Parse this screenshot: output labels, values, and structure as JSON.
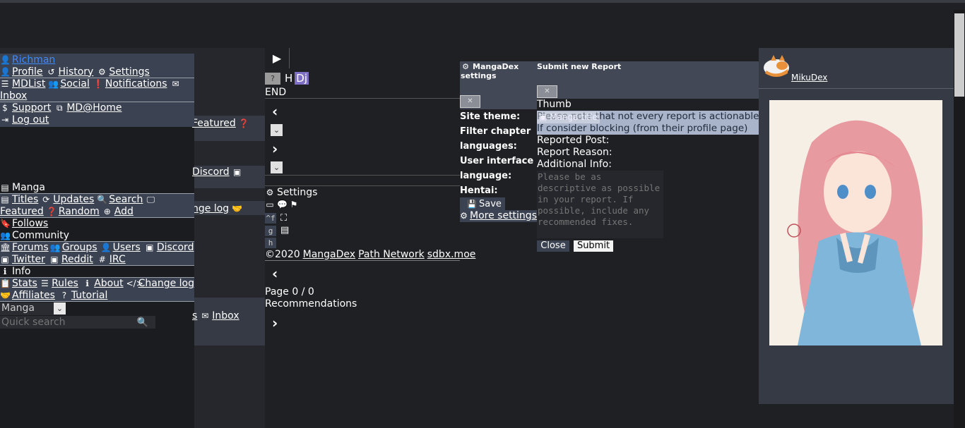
{
  "user_menu": {
    "username": "Richman",
    "profile": "Profile",
    "history": "History",
    "settings": "Settings",
    "mdlist": "MDList",
    "social": "Social",
    "notifications": "Notifications",
    "inbox": "Inbox",
    "support": "Support",
    "md_home": "MD@Home",
    "logout": "Log out"
  },
  "bg_fragments": {
    "featured": "Featured",
    "discord": "Discord",
    "change_log": "nge log",
    "inbox_tail": "s",
    "inbox": "Inbox"
  },
  "main_menu": {
    "manga": "Manga",
    "titles": "Titles",
    "updates": "Updates",
    "search": "Search",
    "featured": "Featured",
    "random": "Random",
    "add": "Add",
    "follows": "Follows",
    "community": "Community",
    "forums": "Forums",
    "groups": "Groups",
    "users": "Users",
    "discord": "Discord",
    "twitter": "Twitter",
    "reddit": "Reddit",
    "irc": "IRC",
    "info": "Info",
    "stats": "Stats",
    "rules": "Rules",
    "about": "About",
    "change_log": "Change log",
    "affiliates": "Affiliates",
    "tutorial": "Tutorial",
    "search_type": "Manga",
    "quick_search_placeholder": "Quick search"
  },
  "reader": {
    "badge_h": "H",
    "badge_dj": "Dj",
    "end": "END",
    "settings": "Settings",
    "kbd1": "^f",
    "kbd2": "g",
    "kbd3": "h",
    "copyright": "©2020",
    "footer_mangadex": "MangaDex",
    "footer_path": "Path Network",
    "footer_sdbx": "sdbx.moe",
    "page_info": "Page 0 / 0",
    "recommendations": "Recommendations"
  },
  "settings_panel": {
    "title": "MangaDex settings",
    "site_theme": "Site theme:",
    "filter_langs": "Filter chapter languages:",
    "ui_lang": "User interface language:",
    "hentai": "Hentai:",
    "save": "Save",
    "more_settings": "More settings"
  },
  "report_panel": {
    "title": "Submit new Report",
    "thumb": "Thumb",
    "notice": "Please note that not every report is actionable. If consider blocking (from their profile page) instead",
    "overlay_text": "Manga title",
    "reported_post": "Reported Post:",
    "report_reason": "Report Reason:",
    "additional_info": "Additional Info:",
    "textarea_placeholder": "Please be as descriptive as possible in your report. If possible, include any recommended fixes.",
    "close": "Close",
    "submit": "Submit"
  },
  "sidebar_right": {
    "username": "MikuDex"
  }
}
